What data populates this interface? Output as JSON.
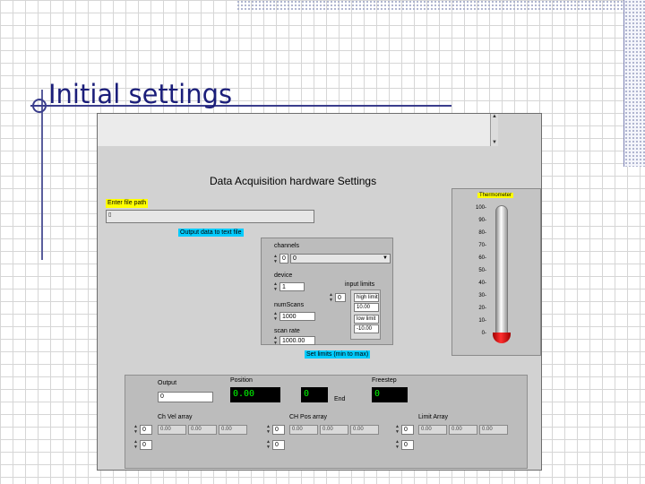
{
  "slide": {
    "title": "Initial settings"
  },
  "vi": {
    "heading": "Data Acquisition hardware Settings",
    "file_path_label": "Enter file path",
    "file_path_value": "",
    "button_output": "Output data to text file",
    "channels_label": "channels",
    "channels_value": "0",
    "channels_list_value": "0",
    "device_label": "device",
    "device_value": "1",
    "num_scans_label": "numScans",
    "num_scans_value": "1000",
    "scan_rate_label": "scan rate",
    "scan_rate_value": "1000.00",
    "input_limits_label": "input limits",
    "input_limits_index": "0",
    "limits": [
      "high limit",
      "10.00",
      "low limit",
      "-10.00"
    ],
    "button_limit": "Set limits (min to max)",
    "thermometer": {
      "label": "Thermometer",
      "ticks": [
        "100-",
        "90-",
        "80-",
        "70-",
        "60-",
        "50-",
        "40-",
        "30-",
        "20-",
        "10-",
        "0-"
      ],
      "value": 0,
      "max": 100
    },
    "lower": {
      "output_label": "Output",
      "output_index": "0",
      "position_label": "Position",
      "position_value": "0.00",
      "mid_value": "0",
      "end_label": "End",
      "freestep_label": "Freestep",
      "freestep_value": "0",
      "arrays": [
        {
          "label": "Ch Vel array",
          "index_top": "0",
          "index_bottom": "0",
          "cells": [
            "0.00",
            "0.00",
            "0.00"
          ]
        },
        {
          "label": "CH Pos array",
          "index_top": "0",
          "index_bottom": "0",
          "cells": [
            "0.00",
            "0.00",
            "0.00"
          ]
        },
        {
          "label": "Limit Array",
          "index_top": "0",
          "index_bottom": "0",
          "cells": [
            "0.00",
            "0.00",
            "0.00"
          ]
        }
      ]
    }
  },
  "colors": {
    "title": "#1b1e7a",
    "lcd_text": "#00ff00",
    "tag_yellow": "#ffff00",
    "tag_cyan": "#00ccff",
    "mercury": "#ff3030"
  }
}
